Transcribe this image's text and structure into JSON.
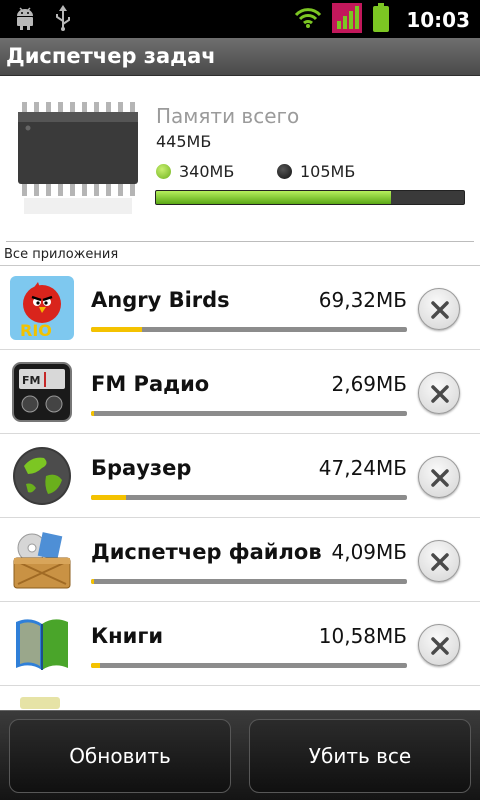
{
  "status_bar": {
    "time": "10:03",
    "icons": [
      "android-icon",
      "usb-icon",
      "wifi-icon",
      "signal-icon",
      "battery-icon"
    ]
  },
  "title_bar": {
    "title": "Диспетчер задач"
  },
  "memory": {
    "title": "Памяти всего",
    "total": "445МБ",
    "used_label": "340МБ",
    "free_label": "105МБ",
    "used_fraction": 0.764,
    "colors": {
      "used": "#7ac030",
      "free": "#1a1a1a"
    }
  },
  "section_label": "Все приложения",
  "apps": [
    {
      "name": "Angry Birds",
      "size": "69,32МБ",
      "usage_fraction": 0.16,
      "icon": "angry-birds-icon"
    },
    {
      "name": "FM Радио",
      "size": "2,69МБ",
      "usage_fraction": 0.01,
      "icon": "fm-radio-icon"
    },
    {
      "name": "Браузер",
      "size": "47,24МБ",
      "usage_fraction": 0.11,
      "icon": "browser-globe-icon"
    },
    {
      "name": "Диспетчер файлов",
      "size": "4,09МБ",
      "usage_fraction": 0.01,
      "icon": "file-manager-icon"
    },
    {
      "name": "Книги",
      "size": "10,58МБ",
      "usage_fraction": 0.03,
      "icon": "books-icon"
    }
  ],
  "buttons": {
    "refresh": "Обновить",
    "kill_all": "Убить все"
  }
}
